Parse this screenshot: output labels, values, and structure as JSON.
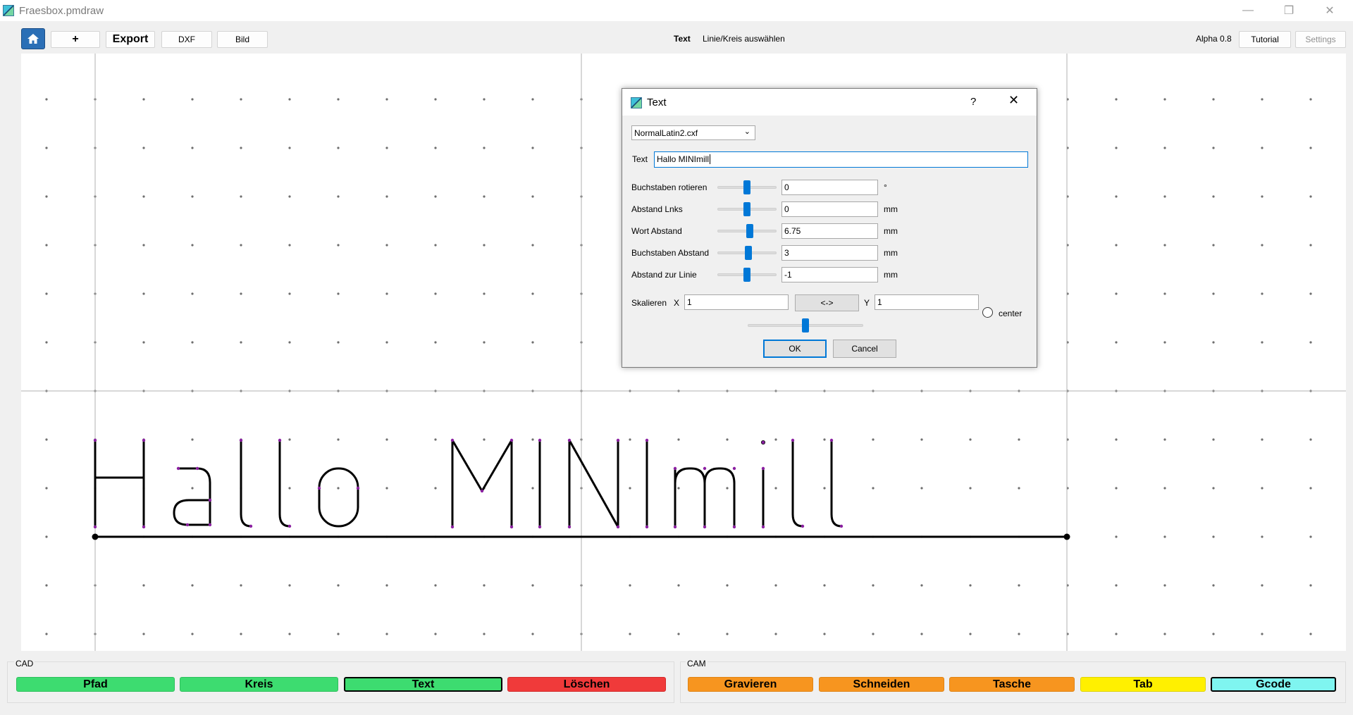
{
  "window": {
    "title": "Fraesbox.pmdraw"
  },
  "toolbar": {
    "add_label": "+",
    "export_label": "Export",
    "dxf_label": "DXF",
    "bild_label": "Bild",
    "status_mode": "Text",
    "status_hint": "Linie/Kreis auswählen",
    "version": "Alpha 0.8",
    "tutorial_label": "Tutorial",
    "settings_label": "Settings"
  },
  "bottom": {
    "cad": {
      "title": "CAD",
      "buttons": [
        {
          "label": "Pfad",
          "color": "#3ddc70"
        },
        {
          "label": "Kreis",
          "color": "#3ddc70"
        },
        {
          "label": "Text",
          "color": "#3ddc70",
          "active": true
        },
        {
          "label": "Löschen",
          "color": "#f03a3a"
        }
      ]
    },
    "cam": {
      "title": "CAM",
      "buttons": [
        {
          "label": "Gravieren",
          "color": "#f7951f"
        },
        {
          "label": "Schneiden",
          "color": "#f7951f"
        },
        {
          "label": "Tasche",
          "color": "#f7951f"
        },
        {
          "label": "Tab",
          "color": "#fff000"
        },
        {
          "label": "Gcode",
          "color": "#7ff5f0",
          "active": true
        }
      ]
    }
  },
  "dialog": {
    "title": "Text",
    "help": "?",
    "font_select": "NormalLatin2.cxf",
    "text_label": "Text",
    "text_value": "Hallo MINImill",
    "params": [
      {
        "label": "Buchstaben rotieren",
        "value": "0",
        "unit": "°",
        "slider": 0.5
      },
      {
        "label": "Abstand Lnks",
        "value": "0",
        "unit": "mm",
        "slider": 0.5
      },
      {
        "label": "Wort Abstand",
        "value": "6.75",
        "unit": "mm",
        "slider": 0.55
      },
      {
        "label": "Buchstaben Abstand",
        "value": "3",
        "unit": "mm",
        "slider": 0.52
      },
      {
        "label": "Abstand zur Linie",
        "value": "-1",
        "unit": "mm",
        "slider": 0.5
      }
    ],
    "scale": {
      "label": "Skalieren",
      "x_label": "X",
      "x_value": "1",
      "swap_label": "<->",
      "y_label": "Y",
      "y_value": "1",
      "center_label": "center",
      "slider": 0.5
    },
    "ok_label": "OK",
    "cancel_label": "Cancel"
  }
}
